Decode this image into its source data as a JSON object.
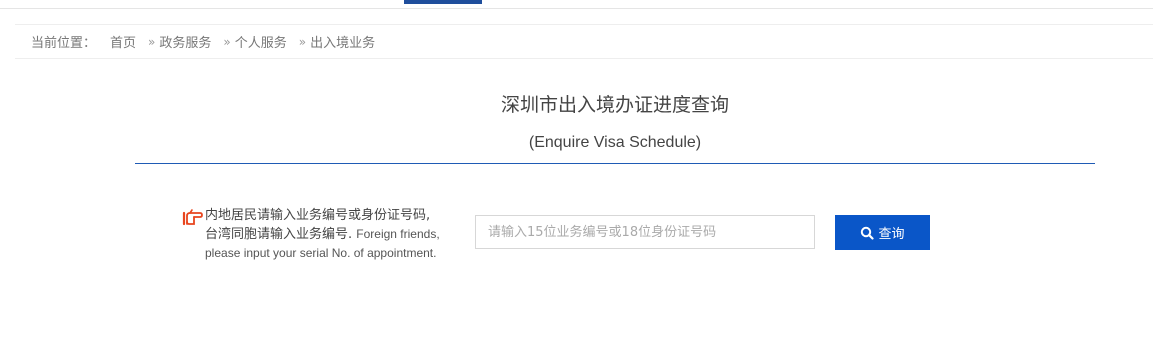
{
  "breadcrumb": {
    "prefix": "当前位置：",
    "separator": "»",
    "items": [
      "首页",
      "政务服务",
      "个人服务",
      "出入境业务"
    ]
  },
  "page": {
    "title_cn": "深圳市出入境办证进度查询",
    "title_en": "(Enquire Visa Schedule)"
  },
  "hint": {
    "icon": "pointing-hand-icon",
    "line1": "内地居民请输入业务编号或身份证号码,",
    "line2": "台湾同胞请输入业务编号.",
    "line2_en": "Foreign friends,",
    "line3_en": "please input your serial No. of appointment."
  },
  "search": {
    "value": "",
    "placeholder": "请输入15位业务编号或18位身份证号码"
  },
  "query_button": {
    "label": "查询",
    "icon": "search-icon"
  },
  "colors": {
    "accent": "#0a56c8",
    "rule": "#1f5bb5",
    "hint_icon": "#e8451e"
  }
}
